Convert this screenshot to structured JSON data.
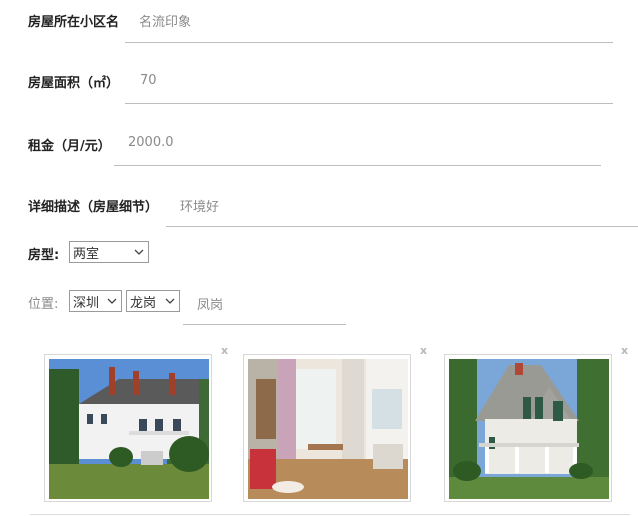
{
  "form": {
    "community": {
      "label": "房屋所在小区名",
      "value": "名流印象"
    },
    "area": {
      "label": "房屋面积（㎡）",
      "value": "70"
    },
    "rent": {
      "label": "租金（月/元）",
      "value": "2000.0"
    },
    "description": {
      "label": "详细描述（房屋细节）",
      "value": "环境好"
    },
    "room_type": {
      "label": "房型:",
      "selected": "两室"
    },
    "location": {
      "label": "位置:",
      "city": "深圳",
      "district": "龙岗",
      "street": "凤岗"
    }
  },
  "photos": {
    "remove_label": "x",
    "items": [
      {
        "name": "house-exterior-photo-1",
        "icon": "photo"
      },
      {
        "name": "interior-room-photo",
        "icon": "photo"
      },
      {
        "name": "house-exterior-photo-2",
        "icon": "photo"
      }
    ]
  },
  "colors": {
    "label": "#222222",
    "value": "#8a8a8a",
    "underline": "#bdbdbd"
  }
}
